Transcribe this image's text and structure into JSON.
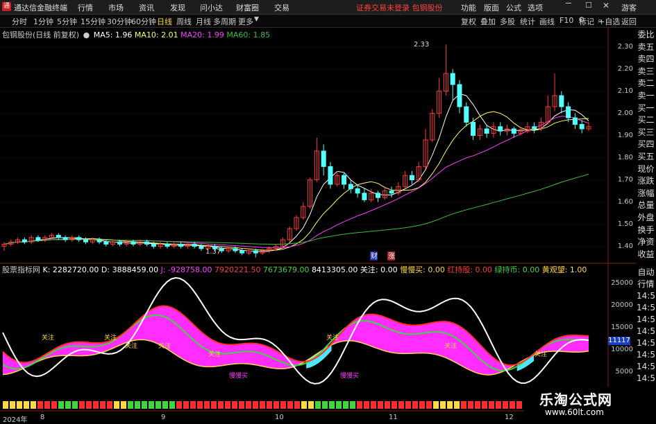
{
  "titlebar": {
    "app_title": "通达信金融终端",
    "menu": [
      "行情",
      "市场",
      "资讯",
      "发现",
      "问小达",
      "财富圈",
      "交易"
    ],
    "notice": "证券交易未登录 包钢股份",
    "right_menu": [
      "功能",
      "版面",
      "公式",
      "选项"
    ],
    "guest": "游客"
  },
  "toolbar": {
    "periods": [
      "分时",
      "1分钟",
      "5分钟",
      "15分钟",
      "30分钟",
      "60分钟",
      "日线",
      "周线",
      "月线",
      "多周期",
      "更多"
    ],
    "active_period": "日线",
    "right_buttons": [
      "复权",
      "叠加",
      "多股",
      "统计",
      "画线",
      "F10",
      "标记",
      "+自选",
      "返回"
    ]
  },
  "main_legend": {
    "name": "包钢股份(日线 前复权)",
    "ma5": "MA5: 1.96",
    "ma10": "MA10: 2.01",
    "ma20": "MA20: 1.99",
    "ma60": "MA60: 1.85"
  },
  "price_axis": [
    "2.30",
    "2.20",
    "2.10",
    "2.00",
    "1.90",
    "1.80",
    "1.70",
    "1.60",
    "1.50",
    "1.40"
  ],
  "annotations": {
    "high": "2.33",
    "low": "1.37",
    "tag_cai": "财",
    "tag_zhang": "涨"
  },
  "indicator_legend": {
    "name": "股票指标网",
    "k": "K: 2282720.00",
    "d": "D: 3888459.00",
    "j": "J: -928758.00",
    "v1": "7920221.50",
    "v2": "7673679.00",
    "v3": "8413305.00",
    "v4": "关注: 0.00",
    "v5": "慢慢买: 0.00",
    "v6": "红持股: 0.00",
    "v7": "绿持币: 0.00",
    "v8": "黄观望: 1.00"
  },
  "indicator_axis": [
    "25000",
    "20000",
    "15000",
    "10000",
    "5000"
  ],
  "indicator_current": "11117",
  "indicator_marks": [
    "关注",
    "关注",
    "关注",
    "关注",
    "关注",
    "关注",
    "关注",
    "关注",
    "慢慢买",
    "慢慢买"
  ],
  "sidebar_top": [
    "委比",
    "卖五",
    "卖四",
    "卖三",
    "卖二",
    "卖一",
    "买一",
    "买二",
    "买三",
    "买四",
    "买五",
    "现价",
    "涨跌",
    "涨幅",
    "总量",
    "外盘",
    "换手",
    "净资",
    "收益"
  ],
  "sidebar_bottom": [
    "自动",
    "行情",
    "14:5",
    "14:5",
    "14:5",
    "14:5",
    "14:5",
    "14:5",
    "14:5",
    "14:5",
    "14:5"
  ],
  "x_axis": [
    "2024年",
    "8",
    "9",
    "10",
    "11",
    "12"
  ],
  "watermark": {
    "title": "乐淘公式网",
    "url": "www.60lt.com"
  },
  "colors": {
    "up": "#ff3b3b",
    "down": "#54ffff",
    "ma5": "#ffffff",
    "ma10": "#ffff66",
    "ma20": "#ff40ff",
    "ma60": "#3fbf3f",
    "k": "#ffffff",
    "d": "#ff2d2d",
    "j": "#3fd63f",
    "yellow": "#ffd94a",
    "magenta": "#ff2dff",
    "cyan": "#4de6ff"
  },
  "chart_data": [
    {
      "type": "candlestick",
      "title": "包钢股份(日线 前复权)",
      "ylim": [
        1.35,
        2.35
      ],
      "series": [
        {
          "name": "MA5",
          "value": 1.96
        },
        {
          "name": "MA10",
          "value": 2.01
        },
        {
          "name": "MA20",
          "value": 1.99
        },
        {
          "name": "MA60",
          "value": 1.85
        }
      ],
      "candles": [
        [
          1.42,
          1.43,
          1.4,
          1.44
        ],
        [
          1.43,
          1.44,
          1.42,
          1.45
        ],
        [
          1.44,
          1.45,
          1.43,
          1.46
        ],
        [
          1.45,
          1.44,
          1.43,
          1.46
        ],
        [
          1.44,
          1.46,
          1.43,
          1.47
        ],
        [
          1.46,
          1.45,
          1.44,
          1.47
        ],
        [
          1.45,
          1.46,
          1.44,
          1.47
        ],
        [
          1.46,
          1.47,
          1.45,
          1.48
        ],
        [
          1.47,
          1.46,
          1.45,
          1.48
        ],
        [
          1.46,
          1.45,
          1.44,
          1.47
        ],
        [
          1.45,
          1.46,
          1.44,
          1.47
        ],
        [
          1.46,
          1.45,
          1.44,
          1.47
        ],
        [
          1.45,
          1.44,
          1.43,
          1.46
        ],
        [
          1.44,
          1.45,
          1.43,
          1.46
        ],
        [
          1.45,
          1.44,
          1.43,
          1.46
        ],
        [
          1.44,
          1.43,
          1.42,
          1.45
        ],
        [
          1.43,
          1.44,
          1.42,
          1.45
        ],
        [
          1.44,
          1.43,
          1.42,
          1.45
        ],
        [
          1.43,
          1.44,
          1.42,
          1.45
        ],
        [
          1.44,
          1.43,
          1.42,
          1.45
        ],
        [
          1.43,
          1.44,
          1.42,
          1.45
        ],
        [
          1.44,
          1.43,
          1.42,
          1.45
        ],
        [
          1.43,
          1.42,
          1.41,
          1.44
        ],
        [
          1.42,
          1.43,
          1.41,
          1.44
        ],
        [
          1.43,
          1.42,
          1.41,
          1.44
        ],
        [
          1.42,
          1.43,
          1.41,
          1.44
        ],
        [
          1.43,
          1.42,
          1.41,
          1.44
        ],
        [
          1.42,
          1.43,
          1.41,
          1.44
        ],
        [
          1.43,
          1.42,
          1.41,
          1.44
        ],
        [
          1.42,
          1.41,
          1.4,
          1.43
        ],
        [
          1.41,
          1.42,
          1.4,
          1.43
        ],
        [
          1.42,
          1.41,
          1.4,
          1.43
        ],
        [
          1.41,
          1.4,
          1.39,
          1.42
        ],
        [
          1.4,
          1.41,
          1.39,
          1.42
        ],
        [
          1.41,
          1.4,
          1.39,
          1.42
        ],
        [
          1.4,
          1.39,
          1.38,
          1.41
        ],
        [
          1.39,
          1.4,
          1.38,
          1.41
        ],
        [
          1.4,
          1.39,
          1.37,
          1.41
        ],
        [
          1.39,
          1.4,
          1.38,
          1.41
        ],
        [
          1.4,
          1.41,
          1.39,
          1.42
        ],
        [
          1.41,
          1.42,
          1.4,
          1.43
        ],
        [
          1.42,
          1.45,
          1.41,
          1.46
        ],
        [
          1.45,
          1.5,
          1.44,
          1.51
        ],
        [
          1.5,
          1.55,
          1.49,
          1.56
        ],
        [
          1.55,
          1.6,
          1.54,
          1.62
        ],
        [
          1.6,
          1.72,
          1.59,
          1.73
        ],
        [
          1.72,
          1.85,
          1.71,
          1.91
        ],
        [
          1.85,
          1.78,
          1.74,
          1.88
        ],
        [
          1.78,
          1.7,
          1.68,
          1.8
        ],
        [
          1.7,
          1.74,
          1.69,
          1.76
        ],
        [
          1.74,
          1.7,
          1.68,
          1.75
        ],
        [
          1.7,
          1.68,
          1.66,
          1.72
        ],
        [
          1.68,
          1.66,
          1.64,
          1.7
        ],
        [
          1.66,
          1.63,
          1.62,
          1.68
        ],
        [
          1.63,
          1.66,
          1.62,
          1.68
        ],
        [
          1.66,
          1.64,
          1.62,
          1.67
        ],
        [
          1.64,
          1.67,
          1.63,
          1.69
        ],
        [
          1.67,
          1.66,
          1.64,
          1.69
        ],
        [
          1.66,
          1.69,
          1.65,
          1.71
        ],
        [
          1.69,
          1.74,
          1.68,
          1.76
        ],
        [
          1.74,
          1.72,
          1.7,
          1.76
        ],
        [
          1.72,
          1.78,
          1.71,
          1.8
        ],
        [
          1.78,
          1.9,
          1.77,
          1.95
        ],
        [
          1.9,
          2.02,
          1.89,
          2.04
        ],
        [
          2.02,
          2.12,
          2.0,
          2.18
        ],
        [
          2.12,
          2.2,
          2.1,
          2.33
        ],
        [
          2.2,
          2.15,
          2.08,
          2.22
        ],
        [
          2.15,
          2.05,
          2.02,
          2.17
        ],
        [
          2.05,
          1.98,
          1.96,
          2.07
        ],
        [
          1.98,
          1.92,
          1.9,
          2.0
        ],
        [
          1.92,
          1.95,
          1.9,
          1.97
        ],
        [
          1.95,
          1.93,
          1.91,
          1.97
        ],
        [
          1.93,
          1.96,
          1.91,
          1.98
        ],
        [
          1.96,
          1.94,
          1.92,
          1.98
        ],
        [
          1.94,
          1.95,
          1.92,
          1.97
        ],
        [
          1.95,
          1.93,
          1.91,
          1.96
        ],
        [
          1.93,
          1.94,
          1.92,
          1.96
        ],
        [
          1.94,
          1.96,
          1.93,
          1.98
        ],
        [
          1.96,
          1.95,
          1.93,
          1.98
        ],
        [
          1.95,
          1.98,
          1.94,
          2.0
        ],
        [
          1.98,
          2.05,
          1.97,
          2.1
        ],
        [
          2.05,
          2.1,
          2.03,
          2.2
        ],
        [
          2.1,
          2.05,
          2.02,
          2.12
        ],
        [
          2.05,
          2.0,
          1.98,
          2.07
        ],
        [
          2.0,
          1.97,
          1.95,
          2.02
        ],
        [
          1.97,
          1.95,
          1.93,
          1.99
        ],
        [
          1.95,
          1.96,
          1.94,
          1.98
        ]
      ]
    },
    {
      "type": "line",
      "title": "股票指标网",
      "ylim": [
        0,
        28000
      ],
      "series": [
        {
          "name": "K",
          "value": 2282720.0
        },
        {
          "name": "D",
          "value": 3888459.0
        },
        {
          "name": "J",
          "value": -928758.0
        }
      ]
    }
  ]
}
